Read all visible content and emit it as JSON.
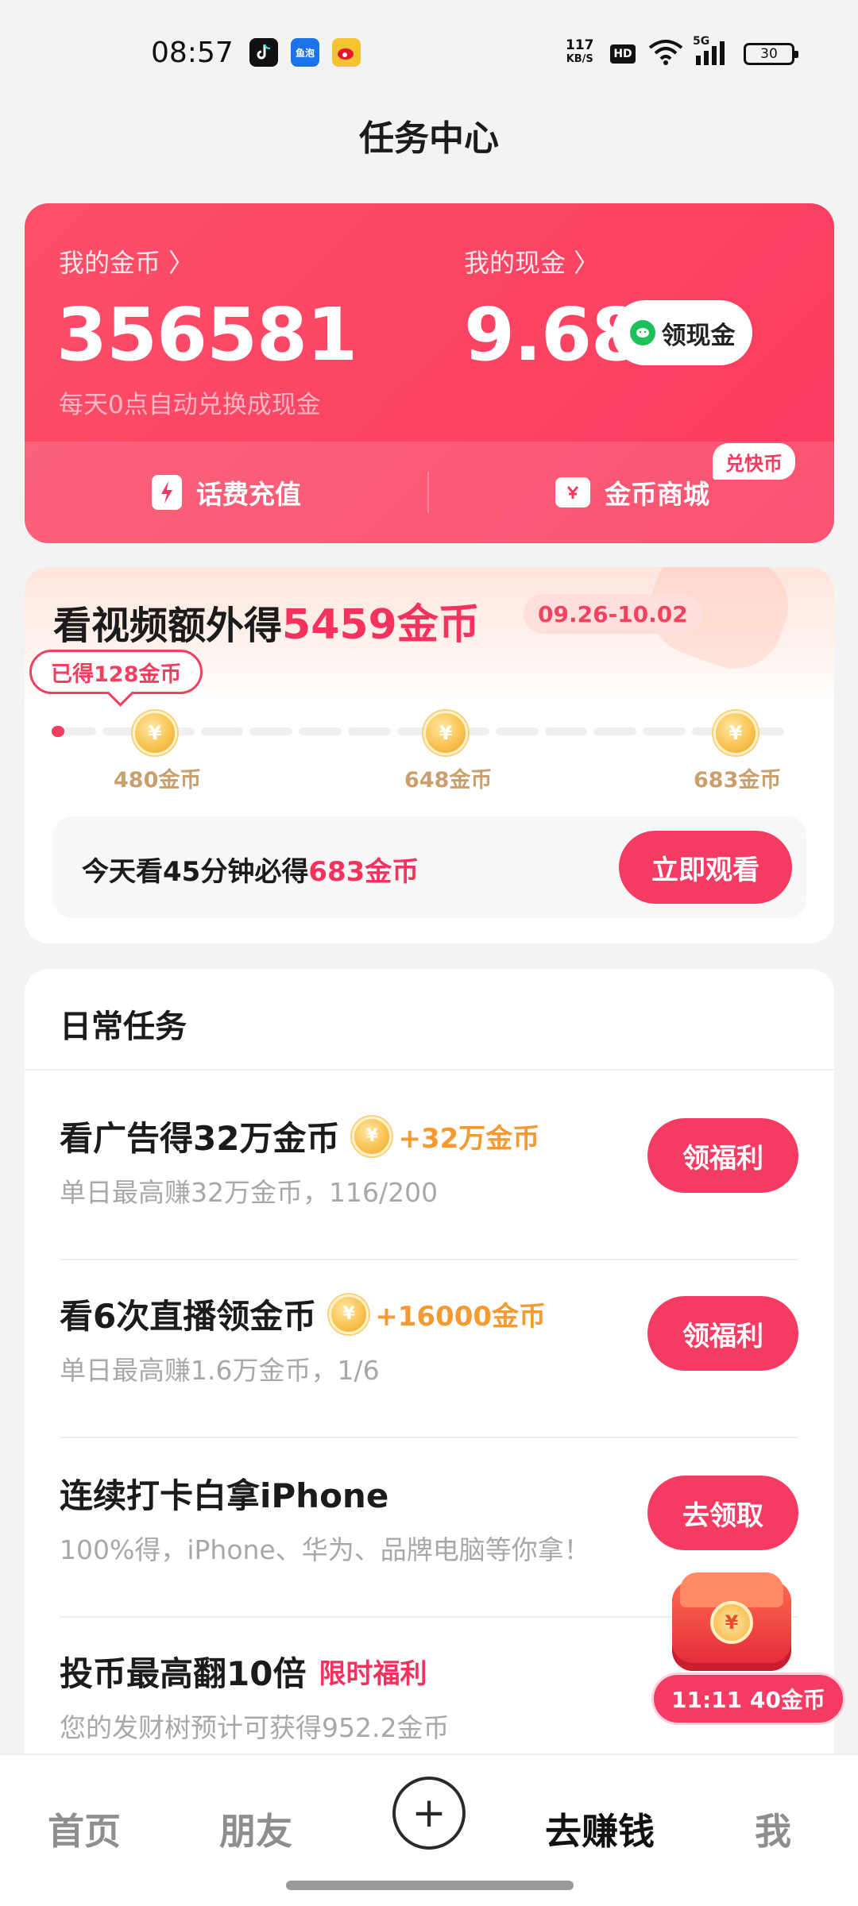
{
  "status_bar": {
    "time": "08:57",
    "speed_value": "117",
    "speed_unit": "KB/S",
    "hd": "HD",
    "network": "5G",
    "battery": "30",
    "apps": [
      "douyin-app-icon",
      "yupao-app-icon",
      "weibo-app-icon"
    ],
    "yupao_label": "鱼泡"
  },
  "header": {
    "title": "任务中心"
  },
  "wallet": {
    "coins_label": "我的金币 〉",
    "coins_value": "356581",
    "cash_label": "我的现金 〉",
    "cash_value": "9.68",
    "cash_button": "领现金",
    "hint": "每天0点自动兑换成现金",
    "recharge_label": "话费充值",
    "mall_label": "金币商城",
    "mall_tag": "兑快币"
  },
  "video_task": {
    "title_prefix": "看视频额外得",
    "title_highlight": "5459金币",
    "date_range": "09.26-10.02",
    "earned": "已得128金币",
    "milestones": [
      {
        "label": "480金币"
      },
      {
        "label": "648金币"
      },
      {
        "label": "683金币"
      }
    ],
    "progress_fraction": 0.01,
    "watch_prefix": "今天看45分钟必得",
    "watch_highlight": "683金币",
    "watch_button": "立即观看"
  },
  "daily": {
    "heading": "日常任务",
    "tasks": [
      {
        "title": "看广告得32万金币",
        "reward": "+32万金币",
        "subtitle": "单日最高赚32万金币，116/200",
        "button": "领福利"
      },
      {
        "title": "看6次直播领金币",
        "reward": "+16000金币",
        "subtitle": "单日最高赚1.6万金币，1/6",
        "button": "领福利"
      },
      {
        "title": "连续打卡白拿iPhone",
        "subtitle": "100%得，iPhone、华为、品牌电脑等你拿！",
        "button": "去领取"
      },
      {
        "title": "投币最高翻10倍",
        "tag": "限时福利",
        "subtitle": "您的发财树预计可获得952.2金币"
      }
    ]
  },
  "floating_chest": {
    "timer_label": "11:11 40金币"
  },
  "coin_symbol": "¥",
  "nav": {
    "items": [
      "首页",
      "朋友",
      "+",
      "去赚钱",
      "我"
    ],
    "active": "去赚钱"
  },
  "colors": {
    "accent": "#f53b62",
    "coin_gold": "#f9c453",
    "reward_orange": "#f59a31"
  }
}
